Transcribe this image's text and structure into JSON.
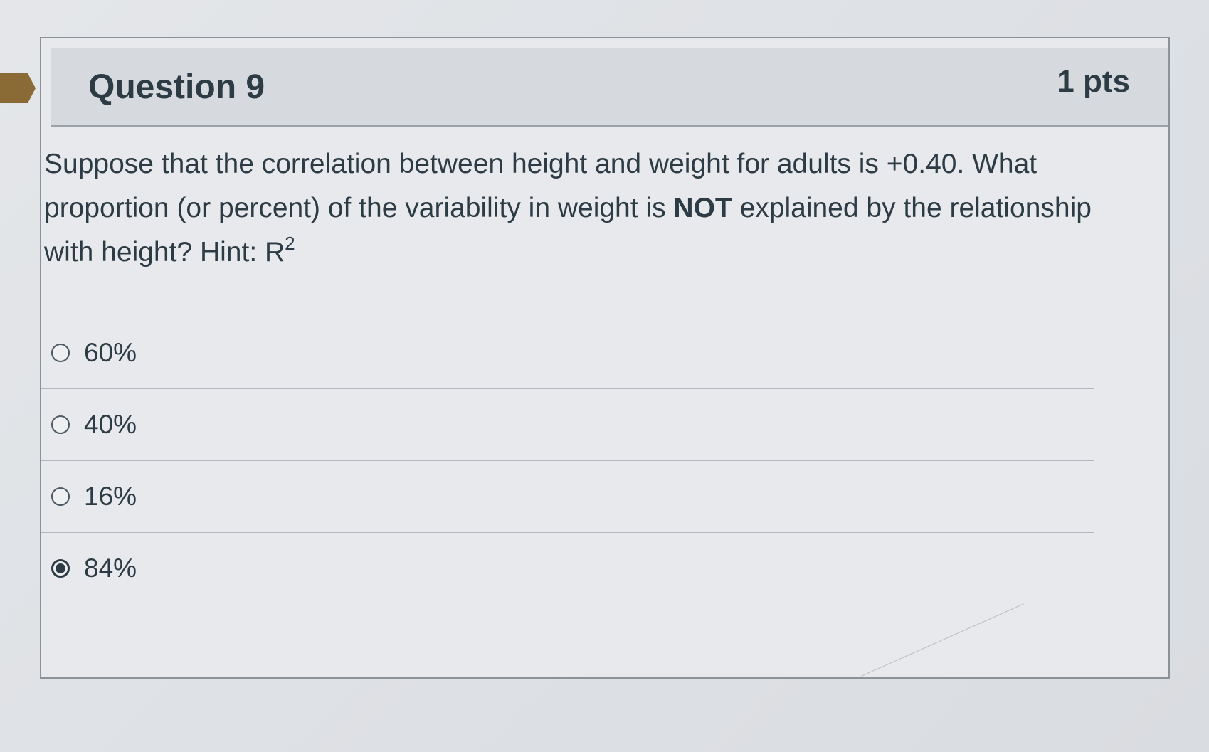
{
  "question": {
    "title": "Question 9",
    "points": "1 pts",
    "text_part1": "Suppose that the correlation between height and weight for adults is +0.40. What proportion (or percent) of the variability in weight is ",
    "text_bold": "NOT",
    "text_part2": " explained by the relationship with height? Hint: R",
    "text_superscript": "2"
  },
  "answers": [
    {
      "label": "60%",
      "selected": false
    },
    {
      "label": "40%",
      "selected": false
    },
    {
      "label": "16%",
      "selected": false
    },
    {
      "label": "84%",
      "selected": true
    }
  ],
  "colors": {
    "flag": "#8a6a35",
    "text": "#2d3b45",
    "header_bg": "#d6d9dd"
  }
}
